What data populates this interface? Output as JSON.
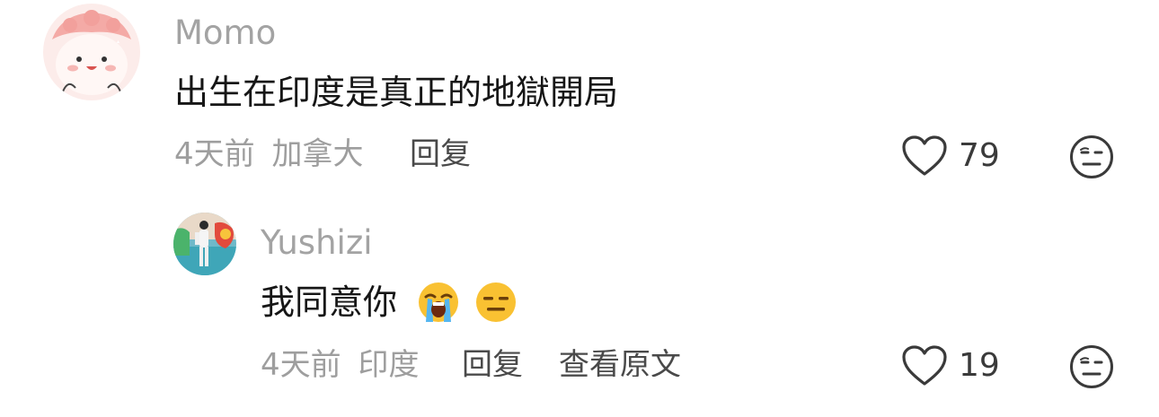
{
  "comments": [
    {
      "username": "Momo",
      "text": "出生在印度是真正的地獄開局",
      "time": "4天前",
      "location": "加拿大",
      "reply_label": "回复",
      "likes": "79"
    },
    {
      "username": "Yushizi",
      "text": "我同意你",
      "emojis": [
        "loudly-crying-face",
        "expressionless-face"
      ],
      "time": "4天前",
      "location": "印度",
      "reply_label": "回复",
      "view_original_label": "查看原文",
      "likes": "19"
    }
  ],
  "colors": {
    "username": "#a3a3a3",
    "text": "#161616",
    "meta": "#9e9e9e",
    "icon": "#3a3a3a"
  }
}
